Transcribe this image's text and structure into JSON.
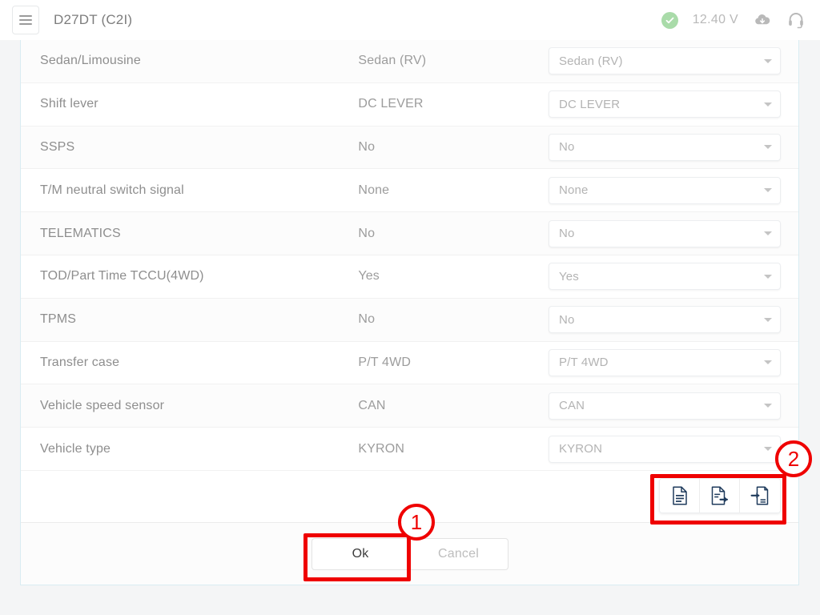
{
  "topbar": {
    "menu_icon": "hamburger-menu-icon",
    "title": "D27DT (C2I)",
    "status_icon": "check-circle-icon",
    "voltage": "12.40 V",
    "cloud_icon": "cloud-download-icon",
    "support_icon": "headset-icon"
  },
  "table": {
    "rows": [
      {
        "label": "Sedan/Limousine",
        "value": "Sedan (RV)",
        "selected": "Sedan (RV)"
      },
      {
        "label": "Shift lever",
        "value": "DC LEVER",
        "selected": "DC LEVER"
      },
      {
        "label": "SSPS",
        "value": "No",
        "selected": "No"
      },
      {
        "label": "T/M neutral switch signal",
        "value": "None",
        "selected": "None"
      },
      {
        "label": "TELEMATICS",
        "value": "No",
        "selected": "No"
      },
      {
        "label": "TOD/Part Time TCCU(4WD)",
        "value": "Yes",
        "selected": "Yes"
      },
      {
        "label": "TPMS",
        "value": "No",
        "selected": "No"
      },
      {
        "label": "Transfer case",
        "value": "P/T 4WD",
        "selected": "P/T 4WD"
      },
      {
        "label": "Vehicle speed sensor",
        "value": "CAN",
        "selected": "CAN"
      },
      {
        "label": "Vehicle type",
        "value": "KYRON",
        "selected": "KYRON"
      }
    ]
  },
  "file_actions": [
    {
      "name": "file-document-icon",
      "label": "Document"
    },
    {
      "name": "file-export-icon",
      "label": "Export"
    },
    {
      "name": "file-import-icon",
      "label": "Import"
    }
  ],
  "footer": {
    "ok_label": "Ok",
    "cancel_label": "Cancel"
  },
  "annotations": [
    {
      "number": "1",
      "target": "ok-button"
    },
    {
      "number": "2",
      "target": "file-actions-toolbar"
    }
  ],
  "colors": {
    "annotation_red": "#ef0000",
    "status_green": "#a9dba9",
    "card_border": "#d9ecf2",
    "icon_navy": "#1f3b5c",
    "page_background": "#f4f5f6"
  }
}
